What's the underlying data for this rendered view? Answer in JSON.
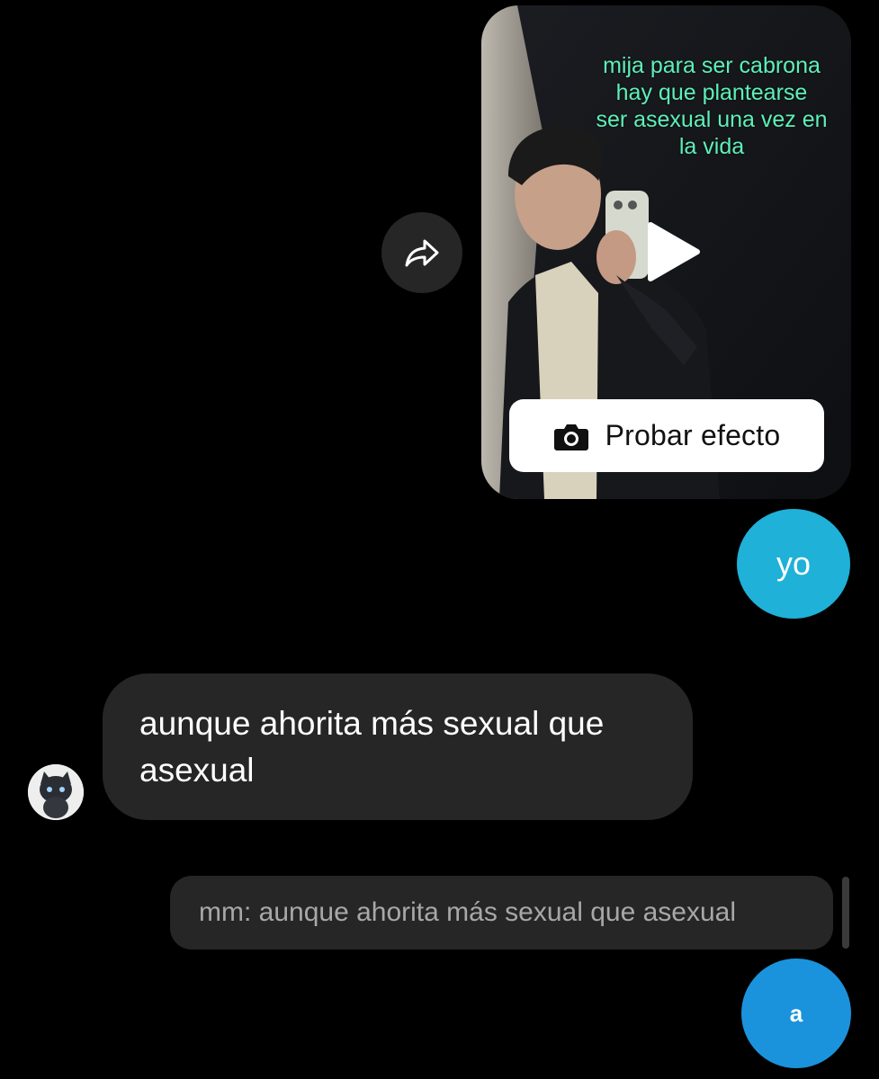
{
  "reel": {
    "caption": "mija para ser cabrona\nhay que plantearse\nser asexual una vez en\nla vida",
    "effect_button_label": "Probar efecto"
  },
  "messages": {
    "outgoing_1": "yo",
    "incoming_1": "aunque ahorita más sexual que asexual",
    "reply_preview": "mm: aunque ahorita más sexual que asexual",
    "outgoing_2": "a"
  },
  "icons": {
    "share": "share-arrow-icon",
    "play": "play-icon",
    "camera": "camera-icon",
    "avatar": "cat-avatar"
  },
  "colors": {
    "background": "#000000",
    "incoming_bubble": "#262626",
    "outgoing_bubble_yo": "#1fb1d8",
    "outgoing_bubble_a": "#1b93dc",
    "reel_caption": "#5ef0b8",
    "reply_text": "#a8a8a8"
  }
}
